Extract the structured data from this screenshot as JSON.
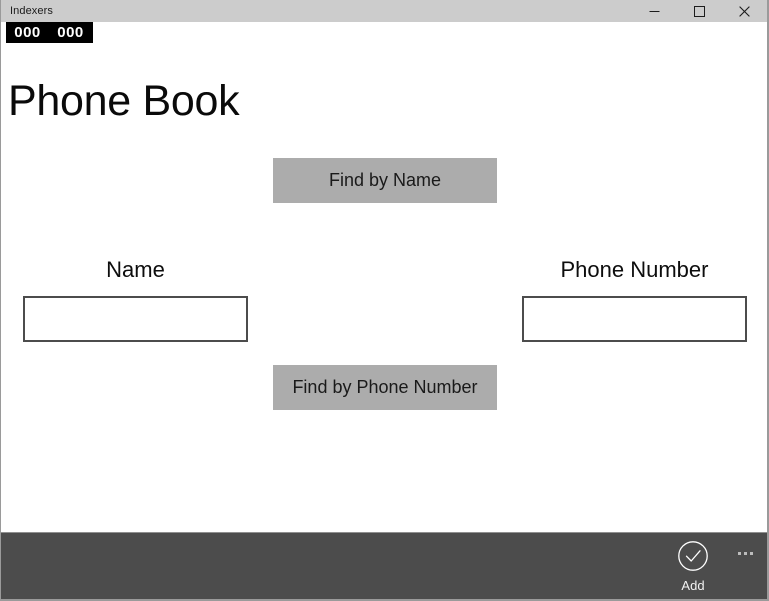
{
  "window": {
    "title": "Indexers",
    "controls": [
      {
        "name": "minimize",
        "glyph": "minimize-icon"
      },
      {
        "name": "maximize",
        "glyph": "maximize-icon"
      },
      {
        "name": "close",
        "glyph": "close-icon"
      }
    ]
  },
  "debug_overlay": {
    "value_left": "000",
    "value_right": "000"
  },
  "page": {
    "title": "Phone Book"
  },
  "buttons": {
    "find_by_name": "Find by Name",
    "find_by_phone": "Find by Phone Number"
  },
  "fields": {
    "name": {
      "label": "Name",
      "value": "",
      "placeholder": ""
    },
    "phone": {
      "label": "Phone Number",
      "value": "",
      "placeholder": ""
    }
  },
  "command_bar": {
    "add": {
      "label": "Add",
      "icon": "accept-check-circle-icon"
    },
    "more": {
      "icon": "more-ellipsis-icon"
    }
  },
  "colors": {
    "titlebar": "#cccccc",
    "button_gray": "#acacac",
    "command_bar": "#4c4c4c",
    "input_border": "#4c4c4c",
    "page_background": "#ffffff",
    "debug_background": "#000000"
  }
}
